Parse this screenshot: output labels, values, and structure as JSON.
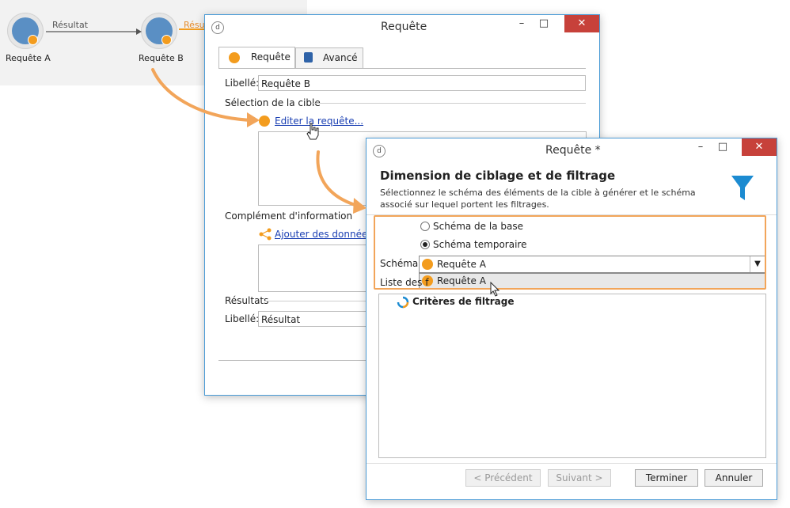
{
  "workflow": {
    "node_a": {
      "label": "Requête A"
    },
    "node_b": {
      "label": "Requête B"
    },
    "transition_1": "Résultat",
    "transition_2": "Résu"
  },
  "dialog1": {
    "title": "Requête",
    "tabs": [
      {
        "label": "Requête"
      },
      {
        "label": "Avancé"
      }
    ],
    "libelle_label": "Libellé:",
    "libelle_value": "Requête B",
    "section_target": "Sélection de la cible",
    "edit_link": "Editer la requête...",
    "section_extra": "Complément d'information",
    "add_data_link": "Ajouter des données...",
    "section_results": "Résultats",
    "results_libelle_label": "Libellé:",
    "results_libelle_value": "Résultat"
  },
  "dialog2": {
    "title": "Requête *",
    "heading": "Dimension de ciblage et de filtrage",
    "description": "Sélectionnez le schéma des éléments de la cible à générer et le schéma associé sur lequel portent les filtrages.",
    "radio_base": "Schéma de la base",
    "radio_temp": "Schéma temporaire",
    "schema_label": "Schéma:",
    "schema_value": "Requête A",
    "dropdown_option": "Requête A",
    "list_label": "Liste des f",
    "criteria_label": "Critères de filtrage",
    "btn_prev": "< Précédent",
    "btn_next": "Suivant >",
    "btn_finish": "Terminer",
    "btn_cancel": "Annuler"
  },
  "colors": {
    "accent": "#f39c1e",
    "window_border": "#4a9bd6",
    "close": "#c7413a",
    "link": "#1a3fb3",
    "highlight": "#f2a55a"
  }
}
